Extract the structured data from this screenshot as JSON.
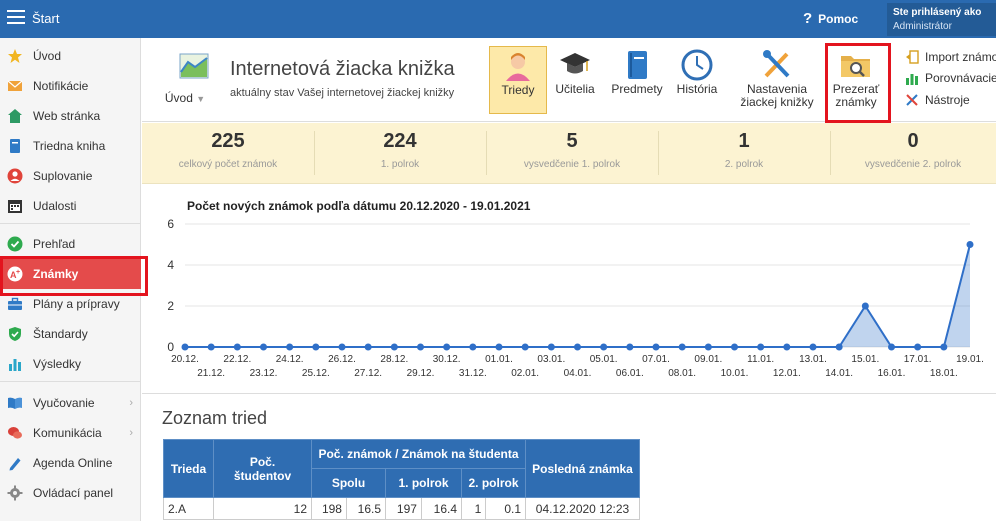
{
  "topbar": {
    "title": "Štart",
    "help_label": "Pomoc",
    "help_icon": "?",
    "login_label": "Ste prihlásený ako",
    "login_user": "Administrátor"
  },
  "sidebar": {
    "items": [
      {
        "label": "Úvod",
        "icon": "star-icon",
        "color": "#f1b520"
      },
      {
        "label": "Notifikácie",
        "icon": "mail-icon",
        "color": "#f0a23a"
      },
      {
        "label": "Web stránka",
        "icon": "house-icon",
        "color": "#2d9a64"
      },
      {
        "label": "Triedna kniha",
        "icon": "book-icon",
        "color": "#2f7ac6"
      },
      {
        "label": "Suplovanie",
        "icon": "user-icon",
        "color": "#e0443a"
      },
      {
        "label": "Udalosti",
        "icon": "calendar-icon",
        "color": "#333333"
      },
      {
        "label": "Prehľad",
        "icon": "check-icon",
        "color": "#2eaa4e"
      },
      {
        "label": "Známky",
        "icon": "grade-icon",
        "color": "#ffffff"
      },
      {
        "label": "Plány a prípravy",
        "icon": "briefcase-icon",
        "color": "#2f7ac6"
      },
      {
        "label": "Štandardy",
        "icon": "shield-icon",
        "color": "#2eaa4e"
      },
      {
        "label": "Výsledky",
        "icon": "bar-chart-icon",
        "color": "#2aa7c9"
      },
      {
        "label": "Vyučovanie",
        "icon": "open-book-icon",
        "color": "#2f7ac6"
      },
      {
        "label": "Komunikácia",
        "icon": "chat-icon",
        "color": "#d9413a"
      },
      {
        "label": "Agenda Online",
        "icon": "pen-icon",
        "color": "#2f7ac6"
      },
      {
        "label": "Ovládací panel",
        "icon": "gear-icon",
        "color": "#888888"
      }
    ],
    "chevron": "›"
  },
  "ribbon": {
    "uvod_label": "Úvod",
    "title": "Internetová žiacka knižka",
    "subtitle": "aktuálny stav Vašej internetovej žiackej knižky",
    "buttons": {
      "triedy": "Triedy",
      "ucitelia": "Učitelia",
      "predmety": "Predmety",
      "historia": "História",
      "nastavenia_1": "Nastavenia",
      "nastavenia_2": "žiackej knižky",
      "prezerat_1": "Prezerať",
      "prezerat_2": "známky"
    },
    "side": {
      "import": "Import známok",
      "porovnavacie": "Porovnávacie",
      "nastroje": "Nástroje"
    }
  },
  "stats": [
    {
      "value": "225",
      "caption": "celkový počet známok"
    },
    {
      "value": "224",
      "caption": "1. polrok"
    },
    {
      "value": "5",
      "caption": "vysvedčenie 1. polrok"
    },
    {
      "value": "1",
      "caption": "2. polrok"
    },
    {
      "value": "0",
      "caption": "vysvedčenie 2. polrok"
    }
  ],
  "chart_data": {
    "type": "area",
    "title": "Počet nových známok podľa dátumu 20.12.2020 - 19.01.2021",
    "x": [
      "20.12.",
      "21.12.",
      "22.12.",
      "23.12.",
      "24.12.",
      "25.12.",
      "26.12.",
      "27.12.",
      "28.12.",
      "29.12.",
      "30.12.",
      "31.12.",
      "01.01.",
      "02.01.",
      "03.01.",
      "04.01.",
      "05.01.",
      "06.01.",
      "07.01.",
      "08.01.",
      "09.01.",
      "10.01.",
      "11.01.",
      "12.01.",
      "13.01.",
      "14.01.",
      "15.01.",
      "16.01.",
      "17.01.",
      "18.01.",
      "19.01."
    ],
    "values": [
      0,
      0,
      0,
      0,
      0,
      0,
      0,
      0,
      0,
      0,
      0,
      0,
      0,
      0,
      0,
      0,
      0,
      0,
      0,
      0,
      0,
      0,
      0,
      0,
      0,
      0,
      2,
      0,
      0,
      0,
      5
    ],
    "yticks": [
      "0",
      "2",
      "4",
      "6"
    ],
    "ylim": [
      0,
      6
    ],
    "grid": true,
    "legend": "none",
    "color": "#2f6fc8"
  },
  "class_list": {
    "title": "Zoznam tried",
    "headers": {
      "trieda": "Trieda",
      "students": "Poč. študentov",
      "group": "Poč. známok / Známok na študenta",
      "spolu": "Spolu",
      "p1": "1. polrok",
      "p2": "2. polrok",
      "last": "Posledná známka"
    },
    "rows": [
      {
        "trieda": "2.A",
        "students": "12",
        "spolu": "198",
        "spolu_avg": "16.5",
        "p1": "197",
        "p1_avg": "16.4",
        "p2": "1",
        "p2_avg": "0.1",
        "last": "04.12.2020 12:23"
      }
    ]
  }
}
